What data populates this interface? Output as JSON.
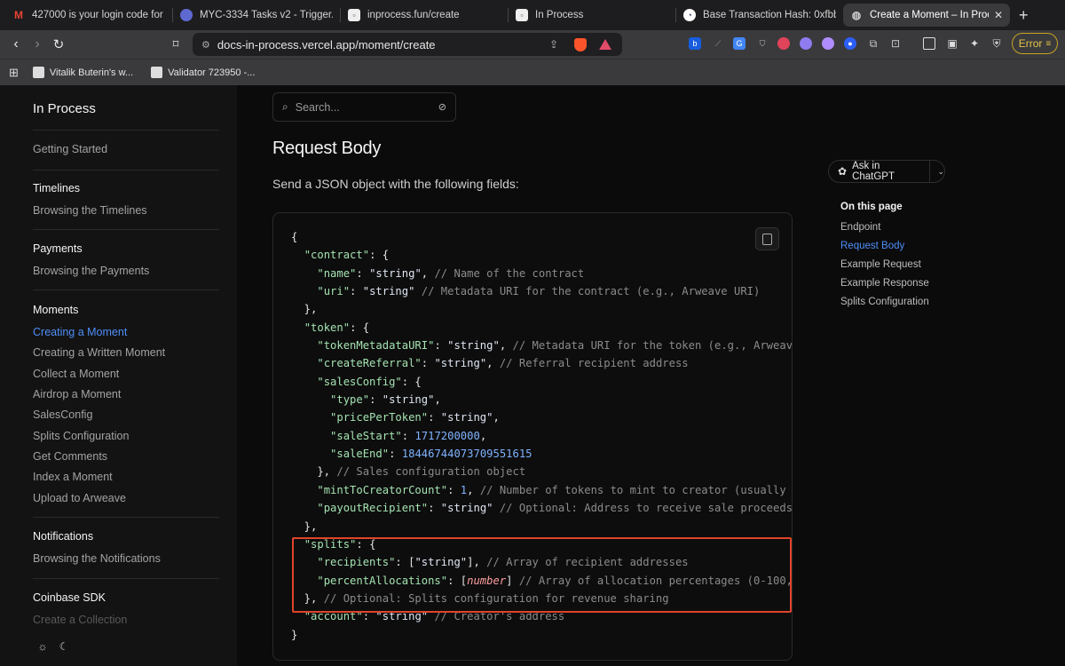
{
  "browser": {
    "tabs": [
      {
        "title": "427000 is your login code for In",
        "icon": "gmail-icon",
        "active": false
      },
      {
        "title": "MYC-3334 Tasks v2 - Trigger.d",
        "icon": "linear-icon",
        "active": false
      },
      {
        "title": "inprocess.fun/create",
        "icon": "page-icon",
        "active": false
      },
      {
        "title": "In Process",
        "icon": "page-icon",
        "active": false
      },
      {
        "title": "Base Transaction Hash: 0xfbbc",
        "icon": "basescan-icon",
        "active": false
      },
      {
        "title": "Create a Moment – In Proce",
        "icon": "globe-icon",
        "active": true
      }
    ],
    "url": "docs-in-process.vercel.app/moment/create",
    "error_label": "Error",
    "bookmarks": [
      {
        "label": "Vitalik Buterin's w..."
      },
      {
        "label": "Validator 723950 -..."
      }
    ]
  },
  "sidebar": {
    "logo": "In Process",
    "getting_started": "Getting Started",
    "timelines_head": "Timelines",
    "timelines_item": "Browsing the Timelines",
    "payments_head": "Payments",
    "payments_item": "Browsing the Payments",
    "moments_head": "Moments",
    "moments_items": [
      "Creating a Moment",
      "Creating a Written Moment",
      "Collect a Moment",
      "Airdrop a Moment",
      "SalesConfig",
      "Splits Configuration",
      "Get Comments",
      "Index a Moment",
      "Upload to Arweave"
    ],
    "notifications_head": "Notifications",
    "notifications_item": "Browsing the Notifications",
    "coinbase_head": "Coinbase SDK",
    "coinbase_item": "Create a Collection"
  },
  "main": {
    "search_placeholder": "Search...",
    "heading": "Request Body",
    "paragraph": "Send a JSON object with the following fields:",
    "ask_label": "Ask in ChatGPT"
  },
  "toc": {
    "heading": "On this page",
    "items": [
      "Endpoint",
      "Request Body",
      "Example Request",
      "Example Response",
      "Splits Configuration"
    ]
  },
  "colors": {
    "accent": "#4f8ef7",
    "highlight_box": "#e0442b",
    "json_key": "#a4e3b1",
    "json_number": "#7fb2ff",
    "comment": "#8b8b8b"
  }
}
